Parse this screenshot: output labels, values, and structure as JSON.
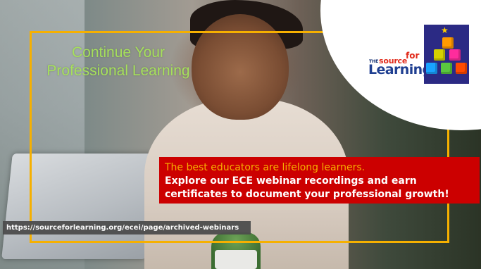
{
  "slide": {
    "headline": {
      "line1": "Continue Your",
      "line2": "Professional Learning"
    },
    "callout": {
      "line1": "The best educators are lifelong learners.",
      "line2": "Explore our ECE webinar recordings and earn",
      "line3": "certificates to document your professional growth!"
    },
    "url": "https://sourceforlearning.org/ecei/page/archived-webinars"
  },
  "logo": {
    "the": "THE",
    "source": "source",
    "for": "for",
    "learning": "Learning"
  },
  "colors": {
    "frame": "#f6b000",
    "headline": "#a6e05c",
    "callout_background": "#cc0000",
    "callout_highlight": "#f6b000",
    "logo_red": "#e12a1a",
    "logo_blue": "#1f3f91",
    "url_bar": "#4d4d4d"
  },
  "icons": {
    "brand_mark": "stacked-blocks-star-logo"
  }
}
